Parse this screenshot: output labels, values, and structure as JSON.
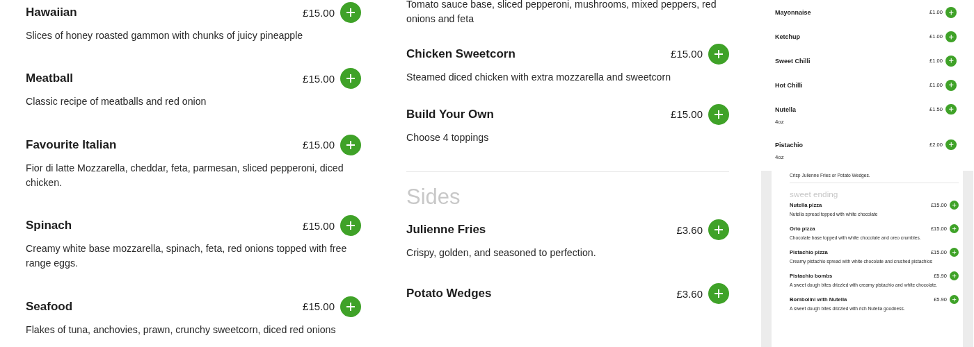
{
  "left_column": {
    "items": [
      {
        "name": "Hawaiian",
        "price": "£15.00",
        "description": "Slices of honey roasted gammon with chunks of juicy pineapple"
      },
      {
        "name": "Meatball",
        "price": "£15.00",
        "description": "Classic recipe of meatballs and red onion"
      },
      {
        "name": "Favourite Italian",
        "price": "£15.00",
        "description": "Fior di latte Mozzarella, cheddar, feta, parmesan, sliced pepperoni, diced chicken."
      },
      {
        "name": "Spinach",
        "price": "£15.00",
        "description": "Creamy white base mozzarella, spinach, feta, red onions topped with free range eggs."
      },
      {
        "name": "Seafood",
        "price": "£15.00",
        "description": "Flakes of tuna, anchovies, prawn, crunchy sweetcorn, diced red onions"
      }
    ]
  },
  "middle_column": {
    "top_description": "Tomato sauce base, sliced pepperoni, mushrooms, mixed peppers, red onions and feta",
    "items": [
      {
        "name": "Chicken Sweetcorn",
        "price": "£15.00",
        "description": "Steamed diced chicken with extra mozzarella and sweetcorn"
      },
      {
        "name": "Build Your Own",
        "price": "£15.00",
        "description": "Choose 4 toppings"
      }
    ],
    "section": {
      "title": "Sides",
      "items": [
        {
          "name": "Julienne Fries",
          "price": "£3.60",
          "description": "Crispy, golden, and seasoned to perfection."
        },
        {
          "name": "Potato Wedges",
          "price": "£3.60"
        }
      ]
    }
  },
  "preview_top": {
    "items": [
      {
        "name": "Mayonnaise",
        "price": "£1.00"
      },
      {
        "name": "Ketchup",
        "price": "£1.00"
      },
      {
        "name": "Sweet Chilli",
        "price": "£1.00"
      },
      {
        "name": "Hot Chilli",
        "price": "£1.00"
      },
      {
        "name": "Nutella",
        "price": "£1.50",
        "description": "4oz"
      },
      {
        "name": "Pistachio",
        "price": "£2.00",
        "description": "4oz"
      }
    ]
  },
  "preview_bottom": {
    "top_description": "Crisp Julienne Fries or Potato Wedges.",
    "section": {
      "title": "sweet ending",
      "items": [
        {
          "name": "Nutella pizza",
          "price": "£15.00",
          "description": "Nutella spread topped with white chocolate"
        },
        {
          "name": "Orio pizza",
          "price": "£15.00",
          "description": "Chocolate base topped with white chocolate and oreo crumbles."
        },
        {
          "name": "Pistachio pizza",
          "price": "£15.00",
          "description": "Creamy pistachio spread with white chocolate and crushed pistachios"
        },
        {
          "name": "Pistachio bombs",
          "price": "£5.90",
          "description": "A sweet dough bites drizzled with creamy pistachio and white chocolate."
        },
        {
          "name": "Bombolini with Nutella",
          "price": "£5.90",
          "description": "A sweet dough bites drizzled with rich Nutella goodness."
        }
      ]
    }
  }
}
